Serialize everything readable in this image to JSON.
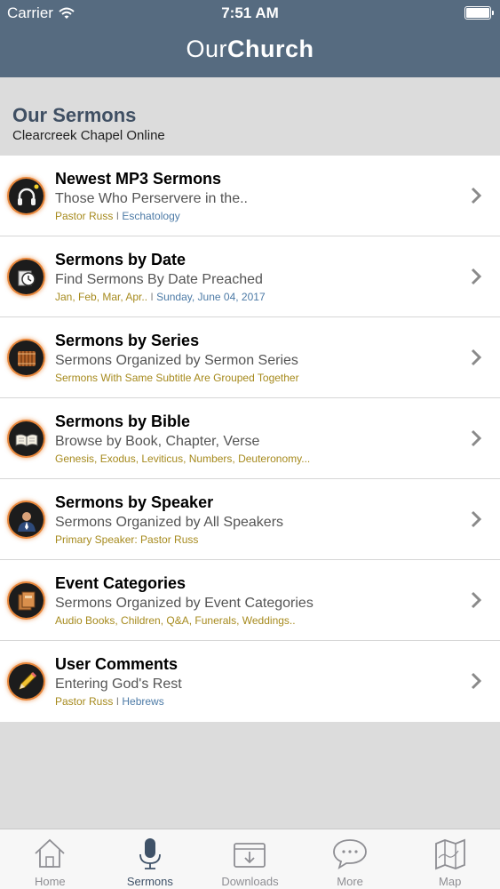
{
  "status_bar": {
    "carrier": "Carrier",
    "time": "7:51 AM"
  },
  "header": {
    "brand_light": "Our",
    "brand_bold": "Church"
  },
  "section": {
    "title": "Our Sermons",
    "subtitle": "Clearcreek Chapel Online"
  },
  "rows": [
    {
      "title": "Newest MP3 Sermons",
      "subtitle": "Those Who Perservere in the..",
      "meta_a": "Pastor Russ",
      "meta_sep": " I ",
      "meta_b": "Eschatology",
      "icon": "headphones-icon"
    },
    {
      "title": "Sermons by Date",
      "subtitle": "Find Sermons By Date Preached",
      "meta_a": "Jan, Feb, Mar, Apr..",
      "meta_sep": " I ",
      "meta_b": "Sunday, June 04, 2017",
      "icon": "calendar-clock-icon"
    },
    {
      "title": "Sermons by Series",
      "subtitle": "Sermons Organized by Sermon Series",
      "meta_a": "Sermons With Same Subtitle Are Grouped Together",
      "meta_sep": "",
      "meta_b": "",
      "icon": "books-icon"
    },
    {
      "title": "Sermons by Bible",
      "subtitle": "Browse by Book, Chapter, Verse",
      "meta_a": "Genesis, Exodus, Leviticus, Numbers, Deuteronomy...",
      "meta_sep": "",
      "meta_b": "",
      "icon": "open-bible-icon"
    },
    {
      "title": "Sermons by Speaker",
      "subtitle": "Sermons Organized by All Speakers",
      "meta_a": "Primary Speaker: Pastor Russ",
      "meta_sep": "",
      "meta_b": "",
      "icon": "speaker-person-icon"
    },
    {
      "title": "Event Categories",
      "subtitle": "Sermons Organized by Event Categories",
      "meta_a": "Audio Books, Children, Q&A, Funerals, Weddings..",
      "meta_sep": "",
      "meta_b": "",
      "icon": "folders-icon"
    },
    {
      "title": "User Comments",
      "subtitle": "Entering God's Rest",
      "meta_a": "Pastor Russ",
      "meta_sep": " I ",
      "meta_b": "Hebrews",
      "icon": "pencil-icon"
    }
  ],
  "tabs": [
    {
      "label": "Home",
      "icon": "home-icon",
      "active": false
    },
    {
      "label": "Sermons",
      "icon": "microphone-icon",
      "active": true
    },
    {
      "label": "Downloads",
      "icon": "download-box-icon",
      "active": false
    },
    {
      "label": "More",
      "icon": "chat-bubble-icon",
      "active": false
    },
    {
      "label": "Map",
      "icon": "map-icon",
      "active": false
    }
  ],
  "colors": {
    "header": "#566b80",
    "accent_gold": "#a68a1d",
    "accent_blue": "#4c7aa6",
    "icon_glow": "#e8863a"
  },
  "battery_level": 1.0
}
